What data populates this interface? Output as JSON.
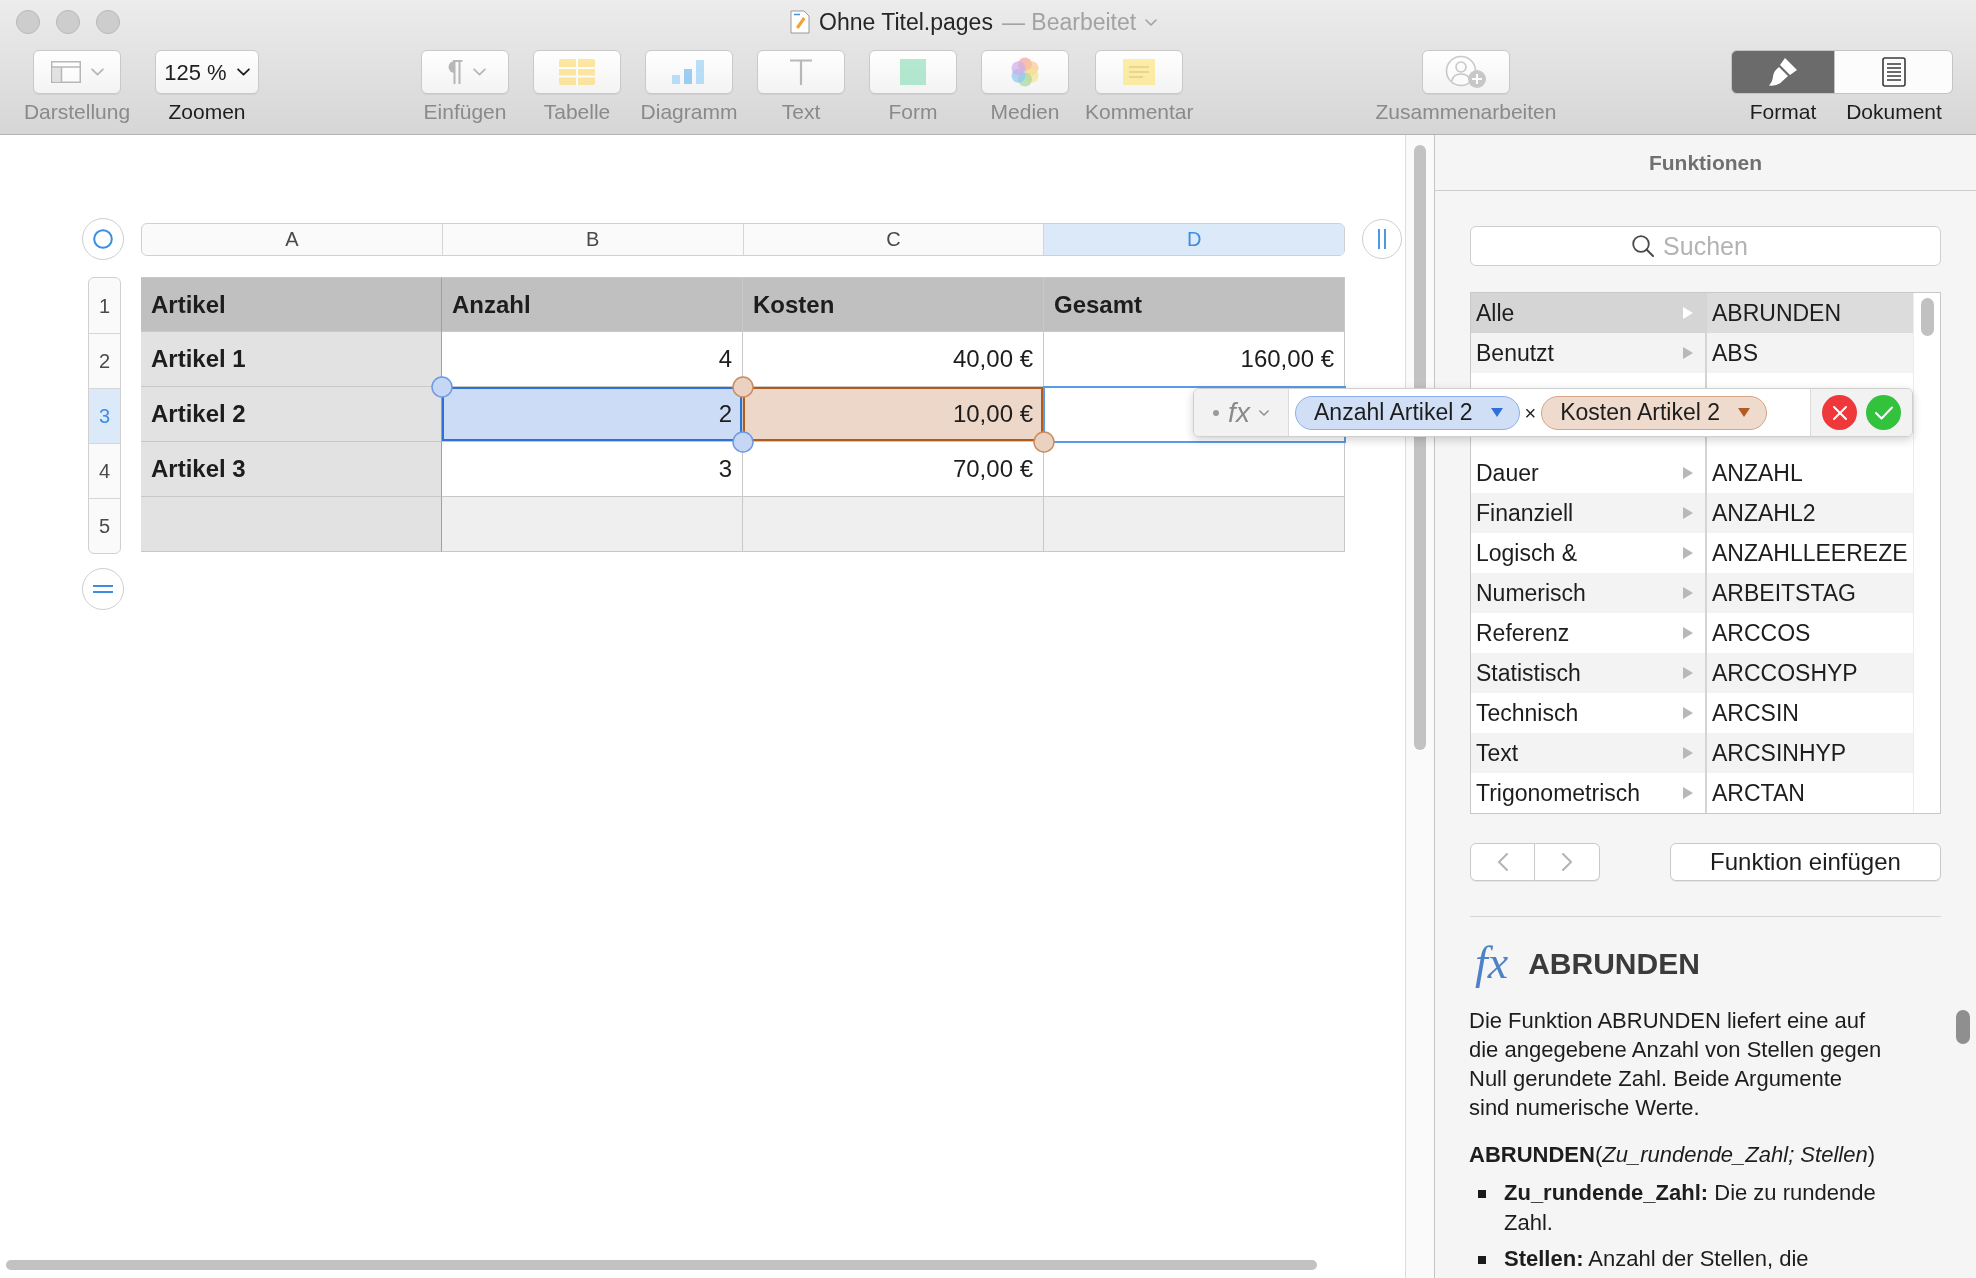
{
  "window": {
    "title": "Ohne Titel.pages",
    "status": "— Bearbeitet"
  },
  "toolbar": {
    "view_group": [
      {
        "kind": "view",
        "label": "Darstellung",
        "disabled": true
      },
      {
        "kind": "zoom",
        "value": "125 %",
        "label": "Zoomen",
        "disabled": false
      }
    ],
    "insert_group": [
      {
        "kind": "insert",
        "label": "Einfügen",
        "disabled": true
      },
      {
        "kind": "table",
        "label": "Tabelle",
        "disabled": true
      },
      {
        "kind": "chart",
        "label": "Diagramm",
        "disabled": true
      },
      {
        "kind": "text",
        "label": "Text",
        "disabled": true
      },
      {
        "kind": "shape",
        "label": "Form",
        "disabled": true
      },
      {
        "kind": "media",
        "label": "Medien",
        "disabled": true
      },
      {
        "kind": "comment",
        "label": "Kommentar",
        "disabled": true
      }
    ],
    "collaborate": {
      "kind": "collaborate",
      "label": "Zusammenarbeiten",
      "disabled": true
    },
    "inspector_tabs": [
      {
        "kind": "format",
        "label": "Format",
        "selected": true
      },
      {
        "kind": "document",
        "label": "Dokument",
        "selected": false
      }
    ]
  },
  "sheet": {
    "columns": [
      {
        "label": "A",
        "selected": false
      },
      {
        "label": "B",
        "selected": false
      },
      {
        "label": "C",
        "selected": false
      },
      {
        "label": "D",
        "selected": true
      }
    ],
    "row_numbers": [
      {
        "label": "1",
        "selected": false
      },
      {
        "label": "2",
        "selected": false
      },
      {
        "label": "3",
        "selected": true
      },
      {
        "label": "4",
        "selected": false
      },
      {
        "label": "5",
        "selected": false
      }
    ],
    "table": {
      "header_column": true,
      "rows": [
        {
          "kind": "header",
          "cells": [
            {
              "text": "Artikel",
              "editing": false
            },
            {
              "text": "Anzahl",
              "editing": false
            },
            {
              "text": "Kosten",
              "editing": false
            },
            {
              "text": "Gesamt",
              "editing": false
            }
          ]
        },
        {
          "kind": "body",
          "cells": [
            {
              "text": "Artikel 1",
              "editing": false
            },
            {
              "text": "4",
              "editing": false
            },
            {
              "text": "40,00 €",
              "editing": false
            },
            {
              "text": "160,00 €",
              "editing": false
            }
          ]
        },
        {
          "kind": "body",
          "cells": [
            {
              "text": "Artikel 2",
              "editing": false
            },
            {
              "text": "2",
              "editing": false,
              "color": "#2f6fd8"
            },
            {
              "text": "10,00 €",
              "editing": false,
              "color": "#b35a1f"
            },
            {
              "editing": true
            }
          ]
        },
        {
          "kind": "body",
          "cells": [
            {
              "text": "Artikel 3",
              "editing": false
            },
            {
              "text": "3",
              "editing": false
            },
            {
              "text": "70,00 €",
              "editing": false
            },
            {
              "editing": false
            }
          ]
        },
        {
          "kind": "footer",
          "cells": [
            {
              "editing": false
            },
            {
              "editing": false
            },
            {
              "editing": false
            },
            {
              "editing": false
            }
          ]
        }
      ]
    },
    "formula_editor": {
      "fx": "fx",
      "parts": [
        {
          "kind": "reference",
          "label": "Anzahl Artikel 2",
          "color": "#2f6fd8"
        },
        {
          "kind": "operator",
          "label": "×"
        },
        {
          "kind": "reference",
          "label": "Kosten Artikel 2",
          "color": "#b35a1f"
        }
      ]
    }
  },
  "sidebar": {
    "title": "Funktionen",
    "search": {
      "placeholder": "Suchen"
    },
    "categories": {
      "above_editor": [
        {
          "label": "Alle",
          "selected": true
        },
        {
          "label": "Benutzt",
          "selected": false
        }
      ],
      "below_editor": [
        {
          "label": "Dauer",
          "selected": false
        },
        {
          "label": "Finanziell",
          "selected": false
        },
        {
          "label": "Logisch &",
          "selected": false
        },
        {
          "label": "Numerisch",
          "selected": false
        },
        {
          "label": "Referenz",
          "selected": false
        },
        {
          "label": "Statistisch",
          "selected": false
        },
        {
          "label": "Technisch",
          "selected": false
        },
        {
          "label": "Text",
          "selected": false
        },
        {
          "label": "Trigonometrisch",
          "selected": false
        }
      ]
    },
    "functions": {
      "above_editor": [
        {
          "label": "ABRUNDEN",
          "selected": true
        },
        {
          "label": "ABS",
          "selected": false
        }
      ],
      "below_editor": [
        {
          "label": "ANZAHL",
          "selected": false
        },
        {
          "label": "ANZAHL2",
          "selected": false
        },
        {
          "label": "ANZAHLLEEREZE",
          "selected": false
        },
        {
          "label": "ARBEITSTAG",
          "selected": false
        },
        {
          "label": "ARCCOS",
          "selected": false
        },
        {
          "label": "ARCCOSHYP",
          "selected": false
        },
        {
          "label": "ARCSIN",
          "selected": false
        },
        {
          "label": "ARCSINHYP",
          "selected": false
        },
        {
          "label": "ARCTAN",
          "selected": false
        }
      ]
    },
    "history_buttons": [
      {
        "kind": "back",
        "disabled": true
      },
      {
        "kind": "forward",
        "disabled": true
      }
    ],
    "insert_button": "Funktion einfügen",
    "detail": {
      "fx": "fx",
      "name": "ABRUNDEN",
      "description": "Die Funktion ABRUNDEN liefert eine auf die angegebene Anzahl von Stellen gegen Null gerundete Zahl. Beide Argumente sind numerische Werte.",
      "syntax": "**ABRUNDEN**(*Zu_rundende_Zahl; Stellen*)",
      "arguments": [
        "**Zu_rundende_Zahl:** Die zu rundende Zahl.",
        "**Stellen:** Anzahl der Stellen, die"
      ]
    }
  }
}
